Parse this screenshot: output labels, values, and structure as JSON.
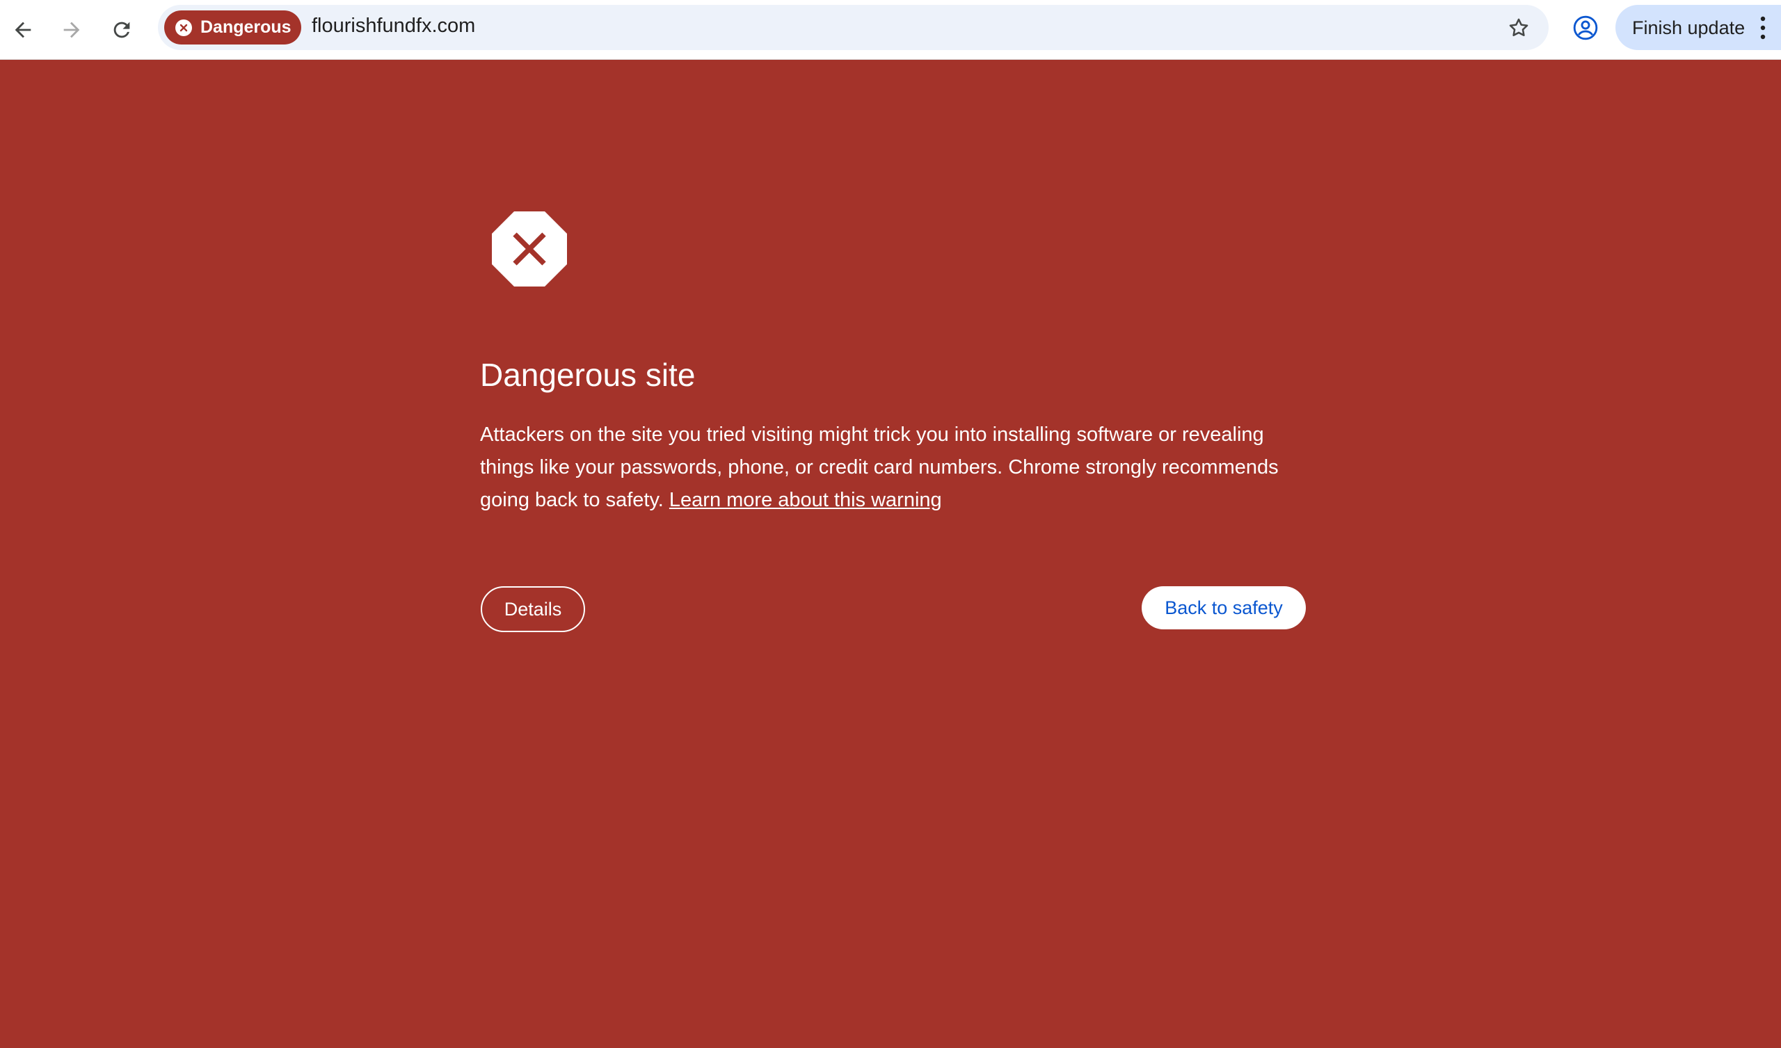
{
  "browser": {
    "security_chip": {
      "label": "Dangerous",
      "icon": "error-x-icon",
      "color": "#a4332a"
    },
    "url": "flourishfundfx.com",
    "update_button_label": "Finish update",
    "icons": {
      "back": "arrow-left-icon",
      "forward": "arrow-right-icon",
      "reload": "reload-icon",
      "bookmark": "star-icon",
      "profile": "account-circle-icon",
      "menu": "three-dots-vertical-icon"
    }
  },
  "interstitial": {
    "background_color": "#a4332a",
    "icon": "stop-x-icon",
    "title": "Dangerous site",
    "body": "Attackers on the site you tried visiting might trick you into installing software or revealing things like your passwords, phone, or credit card numbers. Chrome strongly recommends going back to safety.",
    "learn_more_link": "Learn more about this warning",
    "details_button": "Details",
    "back_to_safety_button": "Back to safety",
    "primary_button_text_color": "#0b57d0"
  }
}
